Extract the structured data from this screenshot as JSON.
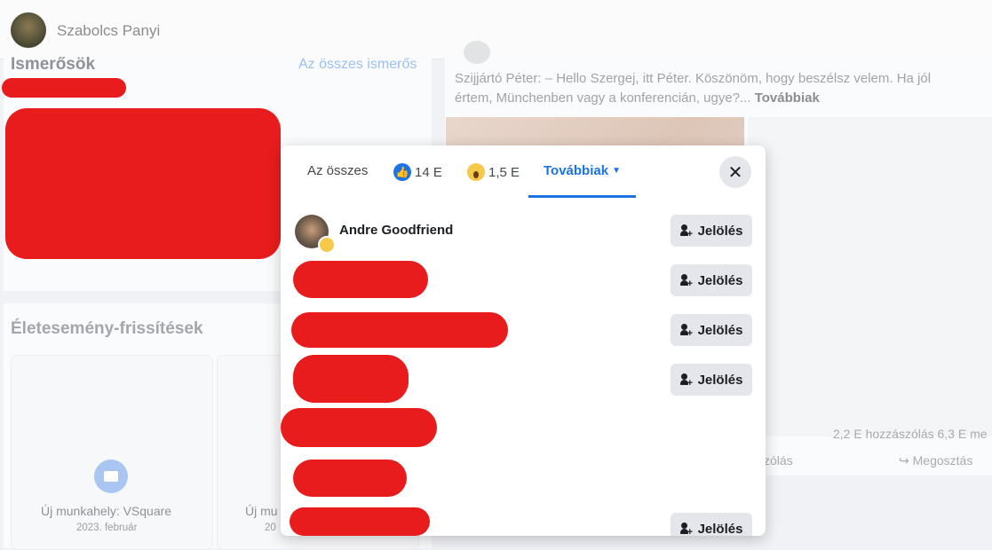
{
  "profile": {
    "name": "Szabolcs Panyi"
  },
  "friends": {
    "title": "Ismerősök",
    "see_all": "Az összes ismerős"
  },
  "life_events": {
    "title": "Életesemény-frissítések",
    "items": [
      {
        "title": "Új munkahely: VSquare",
        "date": "2023. február"
      },
      {
        "title": "Új mu",
        "date": "20"
      }
    ]
  },
  "post": {
    "text": "Szijjártó Péter: – Hello Szergej, itt Péter. Köszönöm, hogy beszélsz velem. Ha jól értem, Münchenben vagy a konferencián, ugye?...",
    "more": "Továbbiak",
    "stats": "2,2 E hozzászólás   6,3 E me",
    "comment_action": "zólás",
    "share_action": "Megosztás"
  },
  "reactions_modal": {
    "tabs": {
      "all": "Az összes",
      "like_count": "14 E",
      "wow_count": "1,5 E",
      "more": "Továbbiak"
    },
    "people": [
      {
        "name": "Andre Goodfriend",
        "button": "Jelölés"
      },
      {
        "name": "",
        "button": "Jelölés"
      },
      {
        "name": "",
        "button": "Jelölés"
      },
      {
        "name": "",
        "button": "Jelölés"
      },
      {
        "name": "",
        "button": ""
      },
      {
        "name": "",
        "button": ""
      },
      {
        "name": "",
        "button": "Jelölés"
      }
    ]
  },
  "colors": {
    "accent": "#1b74e4",
    "redaction": "#e81c1c"
  },
  "icons": {
    "close": "close-icon",
    "like": "like-icon",
    "wow": "wow-icon",
    "add_friend": "add-friend-icon"
  }
}
